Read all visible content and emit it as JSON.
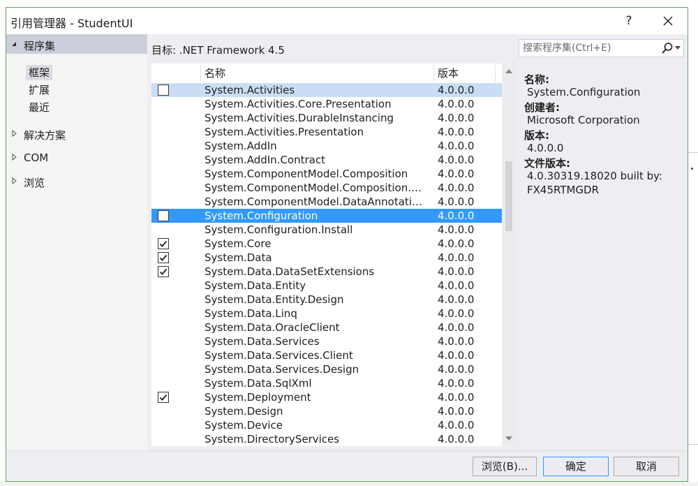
{
  "window": {
    "title": "引用管理器 - StudentUI",
    "help_label": "?"
  },
  "sidebar": {
    "root": "程序集",
    "sub_items": [
      "框架",
      "扩展",
      "最近"
    ],
    "groups": [
      "解决方案",
      "COM",
      "浏览"
    ]
  },
  "target": {
    "label": "目标: .NET Framework 4.5"
  },
  "search": {
    "placeholder": "搜索程序集(Ctrl+E)"
  },
  "grid": {
    "headers": {
      "name": "名称",
      "version": "版本"
    },
    "rows": [
      {
        "name": "System.Activities",
        "version": "4.0.0.0",
        "checkbox": "unchecked",
        "state": "hovered"
      },
      {
        "name": "System.Activities.Core.Presentation",
        "version": "4.0.0.0",
        "checkbox": "none",
        "state": ""
      },
      {
        "name": "System.Activities.DurableInstancing",
        "version": "4.0.0.0",
        "checkbox": "none",
        "state": ""
      },
      {
        "name": "System.Activities.Presentation",
        "version": "4.0.0.0",
        "checkbox": "none",
        "state": ""
      },
      {
        "name": "System.AddIn",
        "version": "4.0.0.0",
        "checkbox": "none",
        "state": ""
      },
      {
        "name": "System.AddIn.Contract",
        "version": "4.0.0.0",
        "checkbox": "none",
        "state": ""
      },
      {
        "name": "System.ComponentModel.Composition",
        "version": "4.0.0.0",
        "checkbox": "none",
        "state": ""
      },
      {
        "name": "System.ComponentModel.Composition.R...",
        "version": "4.0.0.0",
        "checkbox": "none",
        "state": ""
      },
      {
        "name": "System.ComponentModel.DataAnnotations",
        "version": "4.0.0.0",
        "checkbox": "none",
        "state": ""
      },
      {
        "name": "System.Configuration",
        "version": "4.0.0.0",
        "checkbox": "unchecked",
        "state": "selected"
      },
      {
        "name": "System.Configuration.Install",
        "version": "4.0.0.0",
        "checkbox": "none",
        "state": ""
      },
      {
        "name": "System.Core",
        "version": "4.0.0.0",
        "checkbox": "checked",
        "state": ""
      },
      {
        "name": "System.Data",
        "version": "4.0.0.0",
        "checkbox": "checked",
        "state": ""
      },
      {
        "name": "System.Data.DataSetExtensions",
        "version": "4.0.0.0",
        "checkbox": "checked",
        "state": ""
      },
      {
        "name": "System.Data.Entity",
        "version": "4.0.0.0",
        "checkbox": "none",
        "state": ""
      },
      {
        "name": "System.Data.Entity.Design",
        "version": "4.0.0.0",
        "checkbox": "none",
        "state": ""
      },
      {
        "name": "System.Data.Linq",
        "version": "4.0.0.0",
        "checkbox": "none",
        "state": ""
      },
      {
        "name": "System.Data.OracleClient",
        "version": "4.0.0.0",
        "checkbox": "none",
        "state": ""
      },
      {
        "name": "System.Data.Services",
        "version": "4.0.0.0",
        "checkbox": "none",
        "state": ""
      },
      {
        "name": "System.Data.Services.Client",
        "version": "4.0.0.0",
        "checkbox": "none",
        "state": ""
      },
      {
        "name": "System.Data.Services.Design",
        "version": "4.0.0.0",
        "checkbox": "none",
        "state": ""
      },
      {
        "name": "System.Data.SqlXml",
        "version": "4.0.0.0",
        "checkbox": "none",
        "state": ""
      },
      {
        "name": "System.Deployment",
        "version": "4.0.0.0",
        "checkbox": "checked",
        "state": ""
      },
      {
        "name": "System.Design",
        "version": "4.0.0.0",
        "checkbox": "none",
        "state": ""
      },
      {
        "name": "System.Device",
        "version": "4.0.0.0",
        "checkbox": "none",
        "state": ""
      },
      {
        "name": "System.DirectoryServices",
        "version": "4.0.0.0",
        "checkbox": "none",
        "state": ""
      }
    ]
  },
  "details": {
    "name_label": "名称:",
    "name_value": "System.Configuration",
    "creator_label": "创建者:",
    "creator_value": "Microsoft Corporation",
    "version_label": "版本:",
    "version_value": "4.0.0.0",
    "file_version_label": "文件版本:",
    "file_version_value_1": "4.0.30319.18020 built by:",
    "file_version_value_2": "FX45RTMGDR"
  },
  "buttons": {
    "browse": "浏览(B)...",
    "ok": "确定",
    "cancel": "取消"
  },
  "colors": {
    "selection": "#3399ff",
    "hover": "#c9def5",
    "dialog_bg": "#eeeef2",
    "accent_border": "#5aa55a"
  }
}
